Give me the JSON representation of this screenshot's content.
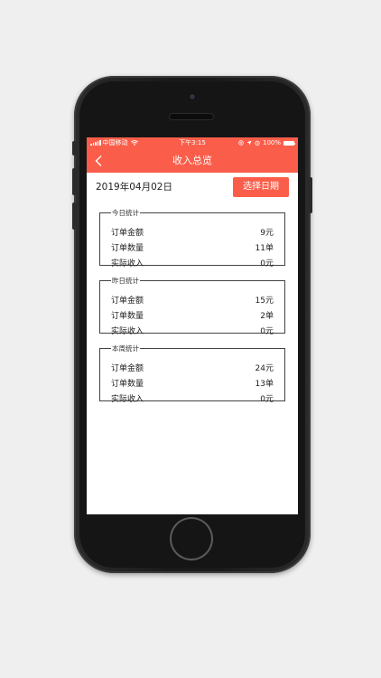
{
  "status_bar": {
    "carrier": "中国移动",
    "time": "下午3:15",
    "battery": "100%",
    "battery_level": 1.0
  },
  "nav": {
    "title": "收入总览",
    "back_icon": "chevron-left-icon"
  },
  "date": {
    "value": "2019年04月02日",
    "button_label": "选择日期"
  },
  "sections": [
    {
      "legend": "今日统计",
      "rows": [
        {
          "label": "订单金额",
          "value": "9元"
        },
        {
          "label": "订单数量",
          "value": "11单"
        },
        {
          "label": "实际收入",
          "value": "0元"
        }
      ]
    },
    {
      "legend": "昨日统计",
      "rows": [
        {
          "label": "订单金额",
          "value": "15元"
        },
        {
          "label": "订单数量",
          "value": "2单"
        },
        {
          "label": "实际收入",
          "value": "0元"
        }
      ]
    },
    {
      "legend": "本周统计",
      "rows": [
        {
          "label": "订单金额",
          "value": "24元"
        },
        {
          "label": "订单数量",
          "value": "13单"
        },
        {
          "label": "实际收入",
          "value": "0元"
        }
      ]
    }
  ],
  "colors": {
    "accent": "#fa5e4a",
    "background": "#efefef"
  }
}
